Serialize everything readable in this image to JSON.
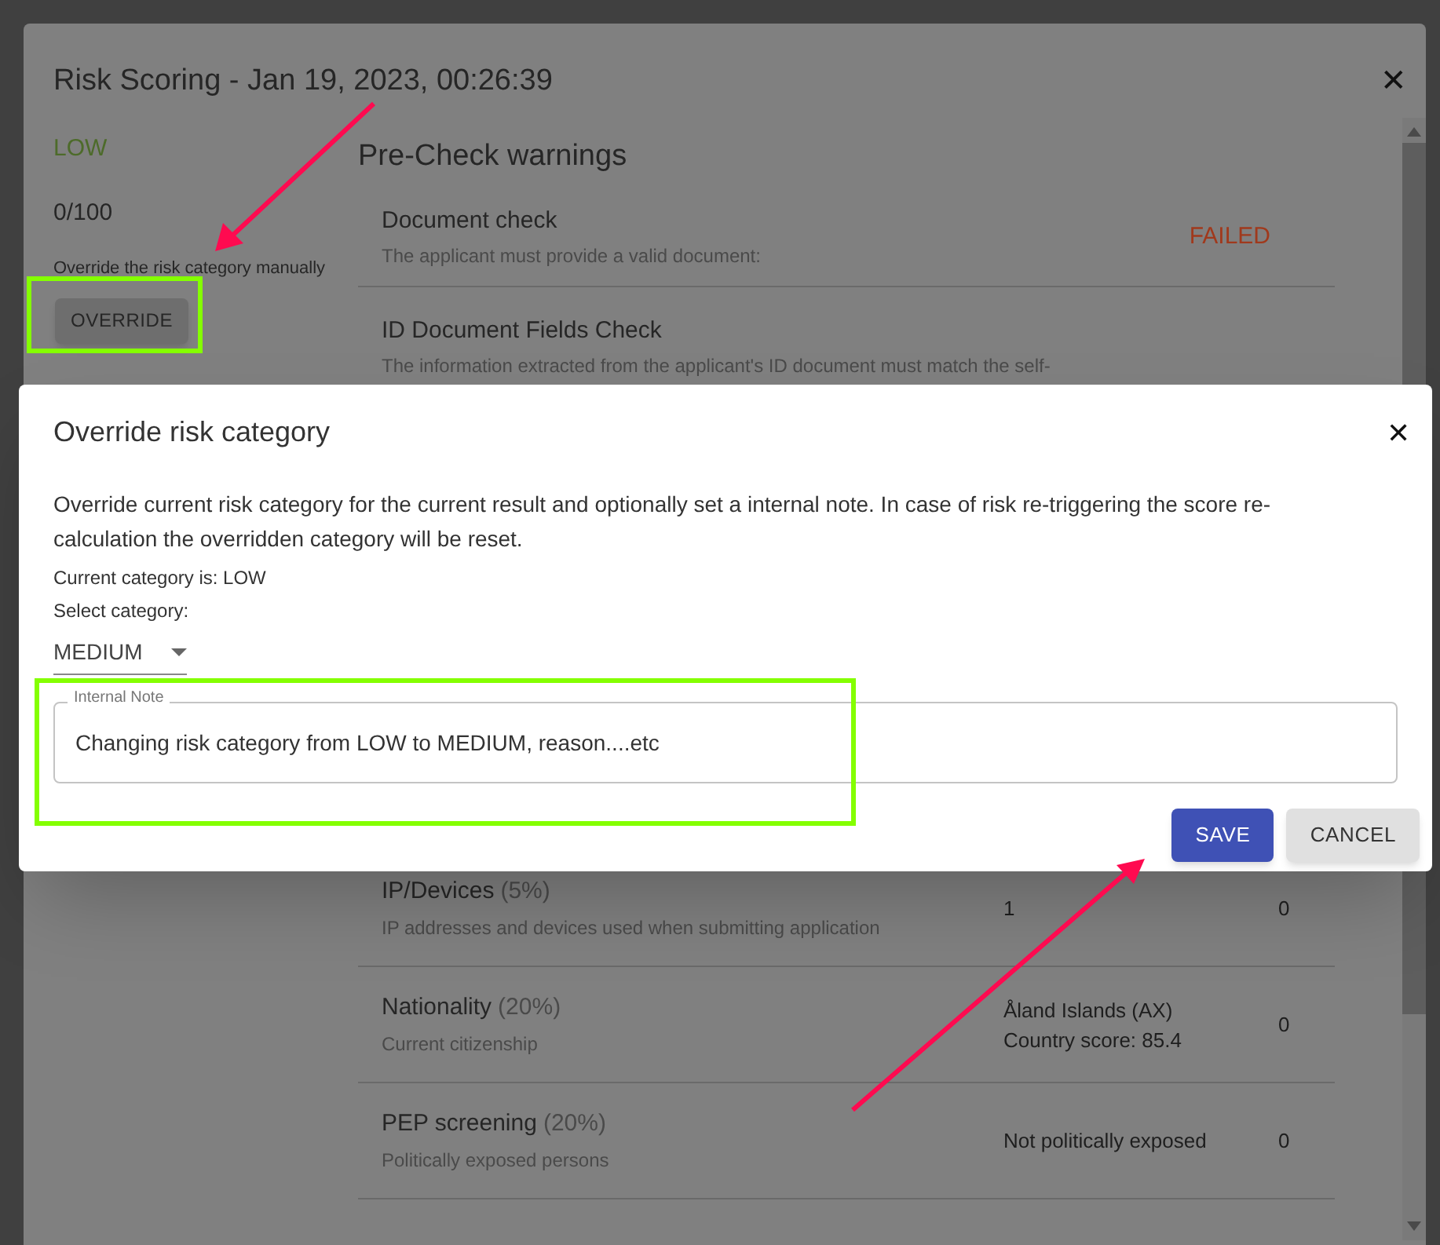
{
  "risk_dialog": {
    "title": "Risk Scoring - Jan 19, 2023, 00:26:39",
    "close": "✕",
    "category": "LOW",
    "score": "0/100",
    "override_label": "Override the risk category manually",
    "override_button": "OVERRIDE",
    "section_title": "Pre-Check warnings",
    "warnings": [
      {
        "title": "Document check",
        "description": "The applicant must provide a valid document:",
        "status": "FAILED"
      },
      {
        "title": "ID Document Fields Check",
        "description": "The information extracted from the applicant's ID document must match the self-"
      }
    ],
    "factors": [
      {
        "name": "IP/Devices",
        "weight": "(5%)",
        "description": "IP addresses and devices used when submitting application",
        "value_lines": [
          "1"
        ],
        "score": "0"
      },
      {
        "name": "Nationality",
        "weight": "(20%)",
        "description": "Current citizenship",
        "value_lines": [
          "Åland Islands (AX)",
          "Country score: 85.4"
        ],
        "score": "0"
      },
      {
        "name": "PEP screening",
        "weight": "(20%)",
        "description": "Politically exposed persons",
        "value_lines": [
          "Not politically exposed"
        ],
        "score": "0"
      }
    ]
  },
  "override_dialog": {
    "title": "Override risk category",
    "close": "✕",
    "description": "Override current risk category for the current result and optionally set a internal note. In case of risk re-triggering the score re-calculation the overridden category will be reset.",
    "current_category": "Current category is: LOW",
    "select_label": "Select category:",
    "select_value": "MEDIUM",
    "note": {
      "label": "Internal Note",
      "value": "Changing risk category from LOW to MEDIUM, reason....etc"
    },
    "buttons": [
      {
        "label": "SAVE",
        "kind": "primary"
      },
      {
        "label": "CANCEL",
        "kind": "secondary"
      }
    ]
  }
}
